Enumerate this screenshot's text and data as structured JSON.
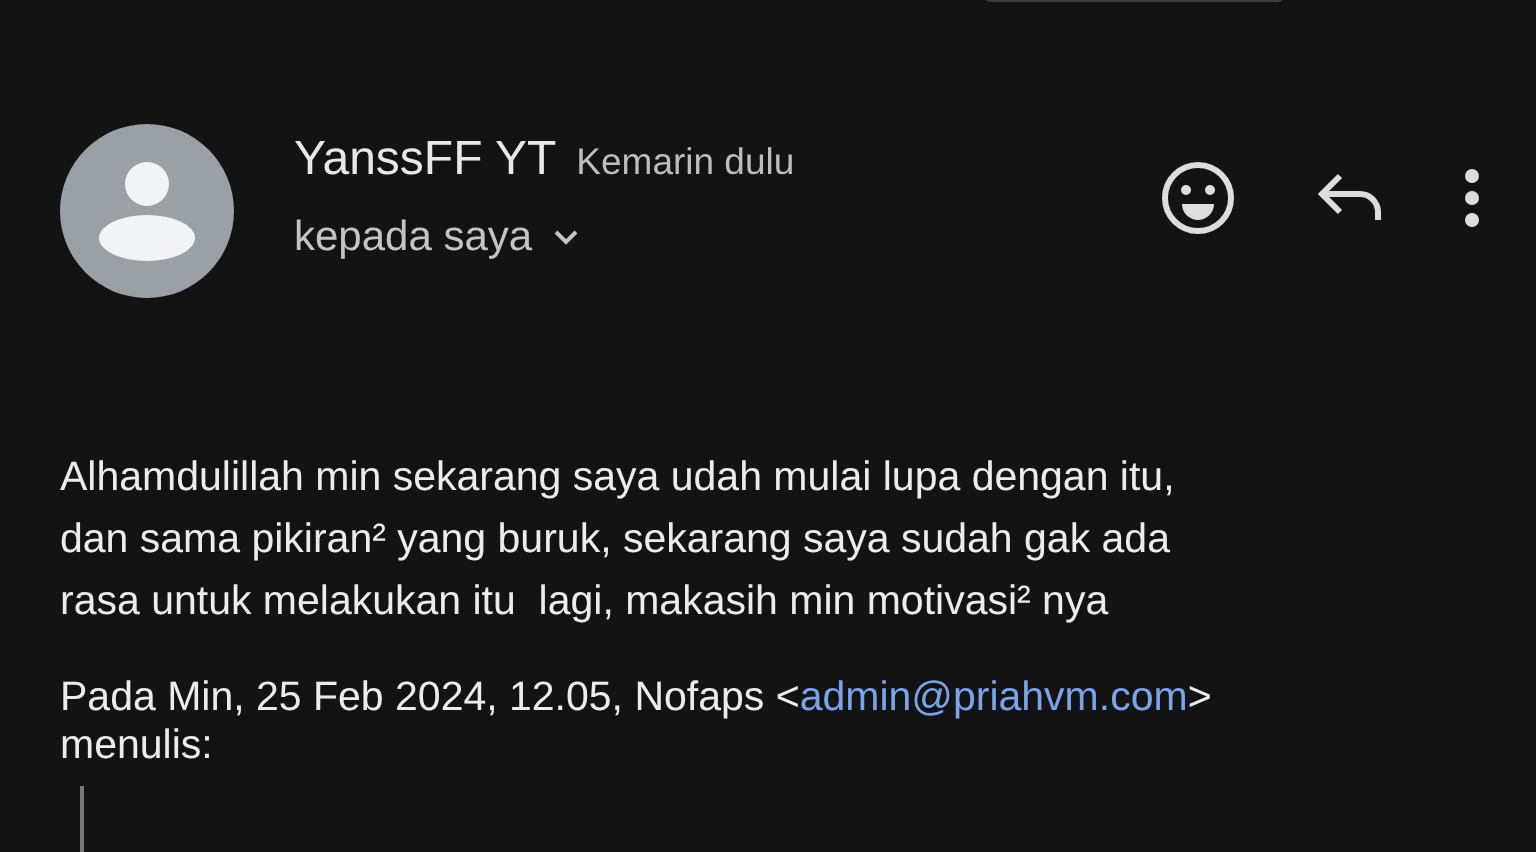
{
  "sender": {
    "name": "YanssFF YT",
    "time": "Kemarin dulu",
    "recipient": "kepada saya"
  },
  "body_lines": [
    "Alhamdulillah min sekarang saya udah mulai lupa dengan itu,",
    "dan sama pikiran² yang buruk, sekarang saya sudah gak ada",
    "rasa untuk melakukan itu  lagi, makasih min motivasi² nya"
  ],
  "attribution": {
    "prefix": "Pada Min, 25 Feb 2024, 12.05, Nofaps <",
    "email": "admin@priahvm.com",
    "suffix": ">",
    "second_line": "menulis:"
  }
}
